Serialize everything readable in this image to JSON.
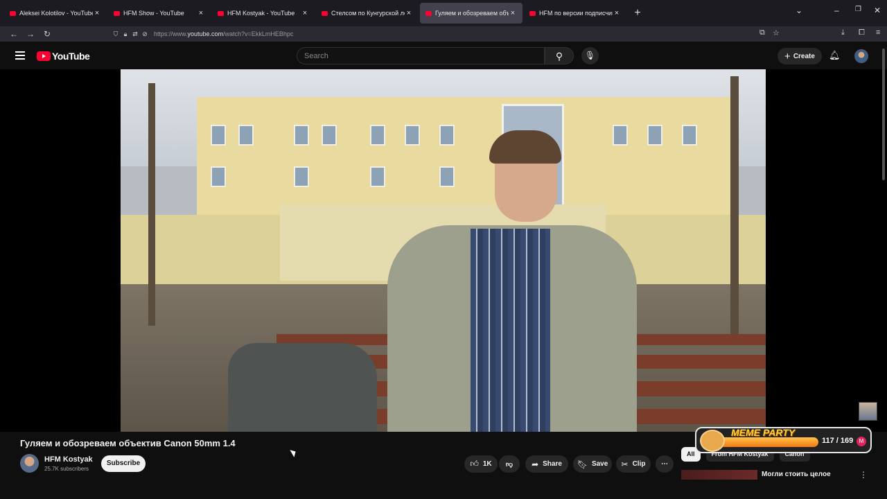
{
  "browser": {
    "tabs": [
      {
        "label": "Aleksei Kolotilov - YouTube",
        "active": false
      },
      {
        "label": "HFM Show - YouTube",
        "active": false
      },
      {
        "label": "HFM Kostyak - YouTube",
        "active": false
      },
      {
        "label": "Стелсом по Кунгурской ледян",
        "active": false
      },
      {
        "label": "Гуляем и обозреваем объекти",
        "active": true
      },
      {
        "label": "HFM по версии подписчиков",
        "active": false
      }
    ],
    "url_prefix": "https://www.",
    "url_domain": "youtube.com",
    "url_path": "/watch?v=EkkLmHEBhpc"
  },
  "header": {
    "logo_text": "YouTube",
    "search_placeholder": "Search",
    "create_label": "Create"
  },
  "video": {
    "title": "Гуляем и обозреваем объектив Canon 50mm 1.4",
    "channel_name": "HFM Kostyak",
    "subscribers": "25.7K subscribers",
    "subscribe_label": "Subscribe",
    "like_count": "1K",
    "share_label": "Share",
    "save_label": "Save",
    "clip_label": "Clip"
  },
  "sidebar": {
    "chips": [
      "All",
      "From HFM Kostyak",
      "Canon"
    ],
    "recommendation_title": "Могли стоить целое"
  },
  "overlay": {
    "title": "MEME PARTY",
    "count": "117 / 169",
    "progress": 0.69
  }
}
